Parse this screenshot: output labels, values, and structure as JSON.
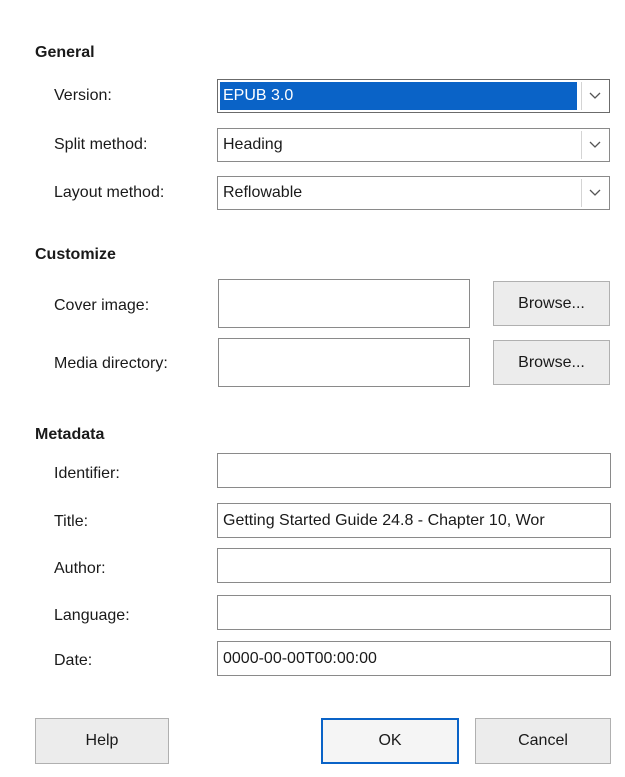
{
  "general": {
    "title": "General",
    "version": {
      "label": "Version:",
      "value": "EPUB 3.0"
    },
    "split_method": {
      "label": "Split method:",
      "value": "Heading"
    },
    "layout_method": {
      "label": "Layout method:",
      "value": "Reflowable"
    }
  },
  "customize": {
    "title": "Customize",
    "cover_image": {
      "label": "Cover image:",
      "value": "",
      "browse": "Browse..."
    },
    "media_directory": {
      "label": "Media directory:",
      "value": "",
      "browse": "Browse..."
    }
  },
  "metadata": {
    "title": "Metadata",
    "identifier": {
      "label": "Identifier:",
      "value": ""
    },
    "doc_title": {
      "label": "Title:",
      "value": "Getting Started Guide 24.8 - Chapter 10, Wor"
    },
    "author": {
      "label": "Author:",
      "value": ""
    },
    "language": {
      "label": "Language:",
      "value": ""
    },
    "date": {
      "label": "Date:",
      "value": "0000-00-00T00:00:00"
    }
  },
  "buttons": {
    "help": "Help",
    "ok": "OK",
    "cancel": "Cancel"
  },
  "colors": {
    "selection": "#0a63c7",
    "button_face": "#ececec"
  }
}
